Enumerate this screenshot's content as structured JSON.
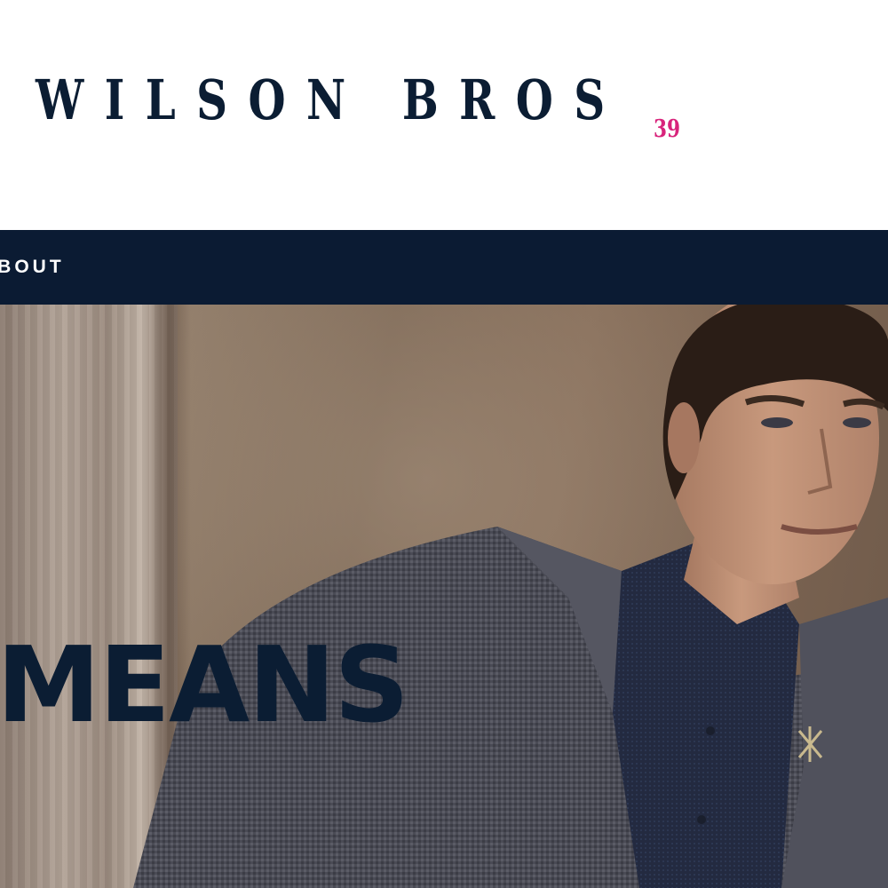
{
  "header": {
    "logo_text": "WILSON BROS",
    "logo_badge": "39",
    "colors": {
      "logo": "#0b1d33",
      "badge": "#d8237b"
    }
  },
  "nav": {
    "items": [
      {
        "label": "ABOUT US"
      }
    ],
    "colors": {
      "background": "#0b1b33",
      "text": "#ffffff"
    }
  },
  "hero": {
    "heading": "MEANS",
    "image": "man-in-checked-blazer-photo",
    "colors": {
      "heading": "#0b1d33"
    }
  }
}
